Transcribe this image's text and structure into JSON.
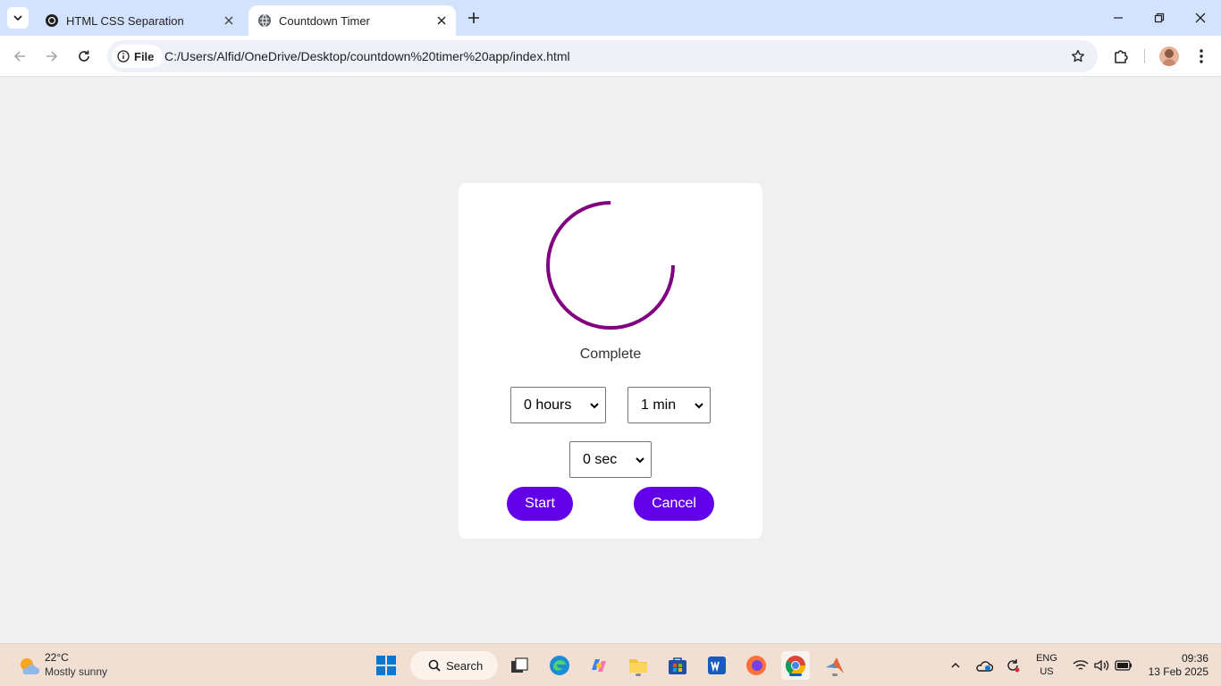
{
  "browser": {
    "tabs": [
      {
        "title": "HTML CSS Separation",
        "active": false
      },
      {
        "title": "Countdown Timer",
        "active": true
      }
    ],
    "address_chip": "File",
    "url": "C:/Users/Alfid/OneDrive/Desktop/countdown%20timer%20app/index.html"
  },
  "timer": {
    "status": "Complete",
    "ring_progress": 0.75,
    "ring_color": "#800080",
    "hours": {
      "selected": "0 hours"
    },
    "minutes": {
      "selected": "1 min"
    },
    "seconds": {
      "selected": "0 sec"
    },
    "start_label": "Start",
    "cancel_label": "Cancel",
    "button_color": "#6200ea"
  },
  "taskbar": {
    "weather": {
      "temp": "22°C",
      "desc": "Mostly sunny"
    },
    "search_label": "Search",
    "lang": {
      "line1": "ENG",
      "line2": "US"
    },
    "clock": {
      "time": "09:36",
      "date": "13 Feb 2025"
    }
  }
}
